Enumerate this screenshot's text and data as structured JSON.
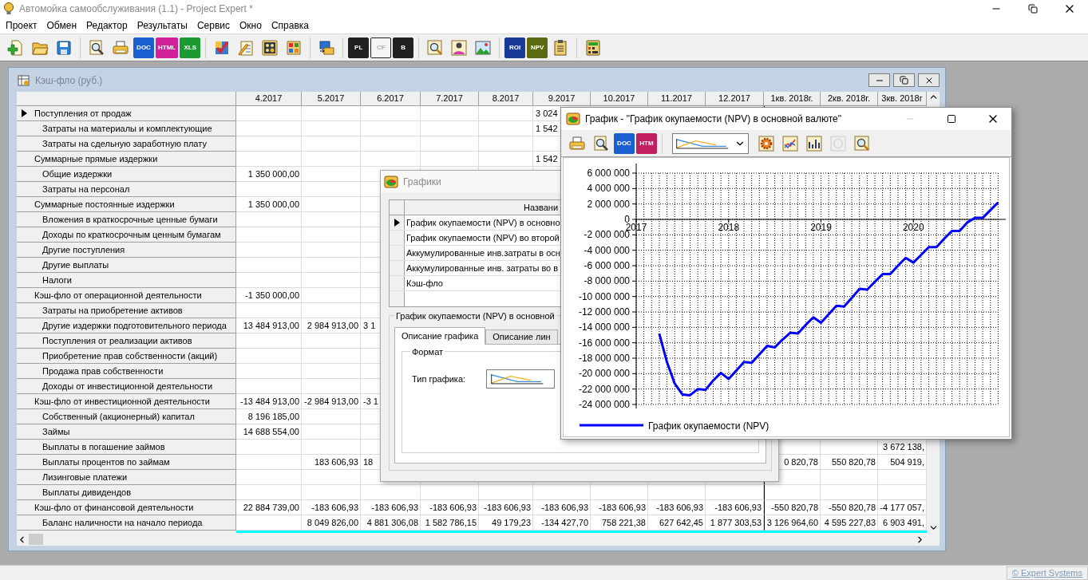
{
  "app": {
    "title": "Автомойка самообслуживания (1.1) - Project Expert *"
  },
  "menu": [
    "Проект",
    "Обмен",
    "Редактор",
    "Результаты",
    "Сервис",
    "Окно",
    "Справка"
  ],
  "toolbar": [
    {
      "kind": "new",
      "disabled": false
    },
    {
      "kind": "open",
      "disabled": false
    },
    {
      "kind": "save",
      "disabled": false
    },
    {
      "kind": "sep"
    },
    {
      "kind": "preview",
      "disabled": false
    },
    {
      "kind": "print",
      "disabled": false
    },
    {
      "kind": "badge",
      "text": "DOC",
      "color": "#1a5fd0",
      "disabled": false
    },
    {
      "kind": "badge",
      "text": "HTML",
      "color": "#d0209a",
      "disabled": false
    },
    {
      "kind": "badge",
      "text": "XLS",
      "color": "#1a9a30",
      "disabled": false
    },
    {
      "kind": "sep"
    },
    {
      "kind": "check",
      "disabled": false
    },
    {
      "kind": "pencil",
      "disabled": false
    },
    {
      "kind": "calc",
      "disabled": false
    },
    {
      "kind": "grid",
      "disabled": false
    },
    {
      "kind": "sep"
    },
    {
      "kind": "transfer",
      "disabled": false
    },
    {
      "kind": "sep"
    },
    {
      "kind": "badge",
      "text": "PL",
      "color": "#202020",
      "disabled": false
    },
    {
      "kind": "badge",
      "text": "CF",
      "color": "#202020",
      "disabled": true
    },
    {
      "kind": "badge",
      "text": "B",
      "color": "#202020",
      "disabled": false
    },
    {
      "kind": "sep"
    },
    {
      "kind": "zoom",
      "disabled": false
    },
    {
      "kind": "person",
      "disabled": false
    },
    {
      "kind": "picture",
      "disabled": false
    },
    {
      "kind": "sep"
    },
    {
      "kind": "badge",
      "text": "ROI",
      "color": "#1a3a9a",
      "disabled": false
    },
    {
      "kind": "badge",
      "text": "NPV",
      "color": "#5a6a10",
      "disabled": false
    },
    {
      "kind": "clipboard",
      "disabled": false
    },
    {
      "kind": "sep"
    },
    {
      "kind": "calculator",
      "disabled": false
    }
  ],
  "cashflow_window": {
    "title": "Кэш-фло (руб.)",
    "active": false,
    "columns": [
      "4.2017",
      "5.2017",
      "6.2017",
      "7.2017",
      "8.2017",
      "9.2017",
      "10.2017",
      "11.2017",
      "12.2017",
      "1кв. 2018г.",
      "2кв. 2018г.",
      "3кв. 2018г"
    ],
    "rows": [
      {
        "label": "Поступления от продаж",
        "kind": "total",
        "selected": true,
        "cells": [
          null,
          null,
          null,
          null,
          null,
          {
            "text": "3 024",
            "clip": true
          },
          null,
          null,
          null,
          null,
          null,
          null
        ]
      },
      {
        "label": "Затраты на материалы и комплектующие",
        "kind": "item",
        "selected": false,
        "cells": [
          null,
          null,
          null,
          null,
          null,
          {
            "text": "1 542",
            "clip": true
          },
          null,
          null,
          null,
          null,
          null,
          null
        ]
      },
      {
        "label": "Затраты на сдельную заработную плату",
        "kind": "item",
        "selected": false,
        "cells": [
          null,
          null,
          null,
          null,
          null,
          null,
          null,
          null,
          null,
          null,
          null,
          null
        ]
      },
      {
        "label": "Суммарные прямые издержки",
        "kind": "total",
        "selected": false,
        "cells": [
          null,
          null,
          null,
          null,
          null,
          {
            "text": "1 542",
            "clip": true
          },
          null,
          null,
          null,
          null,
          null,
          null
        ]
      },
      {
        "label": "Общие издержки",
        "kind": "item",
        "selected": false,
        "cells": [
          "1 350 000,00",
          null,
          null,
          null,
          null,
          null,
          null,
          null,
          null,
          null,
          null,
          null
        ]
      },
      {
        "label": "Затраты на персонал",
        "kind": "item",
        "selected": false,
        "cells": [
          null,
          null,
          null,
          null,
          null,
          null,
          null,
          null,
          null,
          null,
          null,
          null
        ]
      },
      {
        "label": "Суммарные постоянные издержки",
        "kind": "total",
        "selected": false,
        "cells": [
          "1 350 000,00",
          null,
          null,
          null,
          null,
          null,
          null,
          null,
          null,
          null,
          null,
          null
        ]
      },
      {
        "label": "Вложения в краткосрочные ценные бумаги",
        "kind": "item",
        "selected": false,
        "cells": [
          null,
          null,
          null,
          null,
          null,
          null,
          null,
          null,
          null,
          null,
          null,
          null
        ]
      },
      {
        "label": "Доходы по краткосрочным ценным бумагам",
        "kind": "item",
        "selected": false,
        "cells": [
          null,
          null,
          null,
          null,
          null,
          null,
          null,
          null,
          null,
          null,
          null,
          null
        ]
      },
      {
        "label": "Другие поступления",
        "kind": "item",
        "selected": false,
        "cells": [
          null,
          null,
          null,
          null,
          null,
          null,
          null,
          null,
          null,
          null,
          null,
          null
        ]
      },
      {
        "label": "Другие выплаты",
        "kind": "item",
        "selected": false,
        "cells": [
          null,
          null,
          null,
          null,
          null,
          null,
          null,
          null,
          null,
          null,
          null,
          null
        ]
      },
      {
        "label": "Налоги",
        "kind": "item",
        "selected": false,
        "cells": [
          null,
          null,
          null,
          null,
          null,
          null,
          null,
          null,
          null,
          null,
          null,
          null
        ]
      },
      {
        "label": "Кэш-фло от операционной деятельности",
        "kind": "total",
        "selected": false,
        "cells": [
          "-1 350 000,00",
          null,
          null,
          null,
          null,
          null,
          null,
          null,
          null,
          null,
          null,
          null
        ]
      },
      {
        "label": "Затраты на приобретение активов",
        "kind": "item",
        "selected": false,
        "cells": [
          null,
          null,
          null,
          null,
          null,
          null,
          null,
          null,
          null,
          null,
          null,
          null
        ]
      },
      {
        "label": "Другие издержки подготовительного периода",
        "kind": "item",
        "selected": false,
        "cells": [
          "13 484 913,00",
          "2 984 913,00",
          {
            "text": "3 1",
            "clip": true
          },
          null,
          null,
          null,
          null,
          null,
          null,
          null,
          null,
          null
        ]
      },
      {
        "label": "Поступления от реализации активов",
        "kind": "item",
        "selected": false,
        "cells": [
          null,
          null,
          null,
          null,
          null,
          null,
          null,
          null,
          null,
          null,
          null,
          null
        ]
      },
      {
        "label": "Приобретение прав собственности (акций)",
        "kind": "item",
        "selected": false,
        "cells": [
          null,
          null,
          null,
          null,
          null,
          null,
          null,
          null,
          null,
          null,
          null,
          null
        ]
      },
      {
        "label": "Продажа прав собственности",
        "kind": "item",
        "selected": false,
        "cells": [
          null,
          null,
          null,
          null,
          null,
          null,
          null,
          null,
          null,
          null,
          null,
          null
        ]
      },
      {
        "label": "Доходы от инвестиционной деятельности",
        "kind": "item",
        "selected": false,
        "cells": [
          null,
          null,
          null,
          null,
          null,
          null,
          null,
          null,
          null,
          null,
          null,
          null
        ]
      },
      {
        "label": "Кэш-фло от инвестиционной деятельности",
        "kind": "total",
        "selected": false,
        "cells": [
          "-13 484 913,00",
          "-2 984 913,00",
          {
            "text": "-3 1",
            "clip": true
          },
          null,
          null,
          null,
          null,
          null,
          null,
          null,
          null,
          null
        ]
      },
      {
        "label": "Собственный (акционерный) капитал",
        "kind": "item",
        "selected": false,
        "cells": [
          "8 196 185,00",
          null,
          null,
          null,
          null,
          null,
          null,
          null,
          null,
          null,
          null,
          null
        ]
      },
      {
        "label": "Займы",
        "kind": "item",
        "selected": false,
        "cells": [
          "14 688 554,00",
          null,
          null,
          null,
          null,
          null,
          null,
          null,
          null,
          null,
          null,
          null
        ]
      },
      {
        "label": "Выплаты в погашение займов",
        "kind": "item",
        "selected": false,
        "cells": [
          null,
          null,
          null,
          null,
          null,
          null,
          null,
          null,
          null,
          null,
          null,
          "3 672 138,"
        ]
      },
      {
        "label": "Выплаты процентов по займам",
        "kind": "item",
        "selected": false,
        "cells": [
          null,
          "183 606,93",
          {
            "text": "18",
            "clip": true
          },
          null,
          null,
          null,
          null,
          null,
          null,
          "0 820,78",
          "550 820,78",
          "504 919,"
        ]
      },
      {
        "label": "Лизинговые платежи",
        "kind": "item",
        "selected": false,
        "cells": [
          null,
          null,
          null,
          null,
          null,
          null,
          null,
          null,
          null,
          null,
          null,
          null
        ]
      },
      {
        "label": "Выплаты дивидендов",
        "kind": "item",
        "selected": false,
        "cells": [
          null,
          null,
          null,
          null,
          null,
          null,
          null,
          null,
          null,
          null,
          null,
          null
        ]
      },
      {
        "label": "Кэш-фло от финансовой деятельности",
        "kind": "total",
        "selected": false,
        "cells": [
          "22 884 739,00",
          "-183 606,93",
          "-183 606,93",
          "-183 606,93",
          "-183 606,93",
          "-183 606,93",
          "-183 606,93",
          "-183 606,93",
          "-183 606,93",
          "-550 820,78",
          "-550 820,78",
          "-4 177 057,"
        ]
      },
      {
        "label": "Баланс наличности на начало периода",
        "kind": "item",
        "selected": false,
        "cells": [
          null,
          "8 049 826,00",
          "4 881 306,08",
          "1 582 786,15",
          "49 179,23",
          "-134 427,70",
          "758 221,38",
          "627 642,45",
          "1 877 303,53",
          "3 126 964,60",
          "4 595 227,83",
          "6 903 491,"
        ]
      }
    ],
    "partial_row_highlighted": true
  },
  "charts_dialog": {
    "title": "Графики",
    "active": false,
    "list_header": "Названи",
    "items": [
      {
        "name": "График окупаемости (NPV) в основно",
        "selected": true
      },
      {
        "name": "График окупаемости (NPV) во второй",
        "selected": false
      },
      {
        "name": "Аккумулированные инв.затраты в осн",
        "selected": false
      },
      {
        "name": "Аккумулированные инв. затраты во в",
        "selected": false
      },
      {
        "name": "Кэш-фло",
        "selected": false
      }
    ],
    "section_title": "График окупаемости (NPV) в основной",
    "tabs": [
      {
        "label": "Описание графика",
        "selected": true
      },
      {
        "label": "Описание лин",
        "selected": false
      }
    ],
    "format_group": "Формат",
    "chart_type_label": "Тип графика:"
  },
  "chart_window": {
    "title": "График - \"График окупаемости (NPV) в основной валюте\"",
    "active": true,
    "toolbar": [
      {
        "kind": "print",
        "disabled": false
      },
      {
        "kind": "preview",
        "disabled": false
      },
      {
        "kind": "badge",
        "text": "DOC",
        "color": "#1a5fd0",
        "disabled": false
      },
      {
        "kind": "badge",
        "text": "HTM",
        "color": "#c02060",
        "disabled": false
      },
      {
        "kind": "sep"
      },
      {
        "kind": "combo",
        "disabled": false
      },
      {
        "kind": "gear",
        "disabled": false
      },
      {
        "kind": "lines",
        "disabled": false
      },
      {
        "kind": "bars",
        "disabled": false
      },
      {
        "kind": "cube",
        "disabled": true
      },
      {
        "kind": "zoom",
        "disabled": false
      }
    ],
    "chart_data": {
      "type": "line",
      "grid": true,
      "xlim": [
        2017,
        2021
      ],
      "ylim": [
        -24000000,
        6000000
      ],
      "xticks": [
        2017,
        2018,
        2019,
        2020
      ],
      "yticks": [
        {
          "value": 6000000,
          "label": "6 000 000"
        },
        {
          "value": 4000000,
          "label": "4 000 000"
        },
        {
          "value": 2000000,
          "label": "2 000 000"
        },
        {
          "value": 0,
          "label": "0"
        },
        {
          "value": -2000000,
          "label": "-2 000 000"
        },
        {
          "value": -4000000,
          "label": "-4 000 000"
        },
        {
          "value": -6000000,
          "label": "-6 000 000"
        },
        {
          "value": -8000000,
          "label": "-8 000 000"
        },
        {
          "value": -10000000,
          "label": "-10 000 000"
        },
        {
          "value": -12000000,
          "label": "-12 000 000"
        },
        {
          "value": -14000000,
          "label": "-14 000 000"
        },
        {
          "value": -16000000,
          "label": "-16 000 000"
        },
        {
          "value": -18000000,
          "label": "-18 000 000"
        },
        {
          "value": -20000000,
          "label": "-20 000 000"
        },
        {
          "value": -22000000,
          "label": "-22 000 000"
        },
        {
          "value": -24000000,
          "label": "-24 000 000"
        }
      ],
      "x": [
        2017.25,
        2017.333,
        2017.417,
        2017.5,
        2017.583,
        2017.667,
        2017.75,
        2017.833,
        2017.917,
        2018,
        2018.083,
        2018.167,
        2018.25,
        2018.333,
        2018.417,
        2018.5,
        2018.583,
        2018.667,
        2018.75,
        2018.833,
        2018.917,
        2019,
        2019.083,
        2019.167,
        2019.25,
        2019.333,
        2019.417,
        2019.5,
        2019.583,
        2019.667,
        2019.75,
        2019.833,
        2019.917,
        2020,
        2020.083,
        2020.167,
        2020.25,
        2020.333,
        2020.417,
        2020.5,
        2020.583,
        2020.667,
        2020.75,
        2020.833,
        2020.917
      ],
      "series": [
        {
          "name": "График окупаемости (NPV)",
          "color": "#0000ff",
          "values": [
            -14800000,
            -18500000,
            -21300000,
            -22700000,
            -22800000,
            -22000000,
            -22100000,
            -20900000,
            -19900000,
            -20700000,
            -19600000,
            -18500000,
            -18600000,
            -17500000,
            -16400000,
            -16600000,
            -15600000,
            -14700000,
            -14800000,
            -13700000,
            -12700000,
            -13400000,
            -12300000,
            -11200000,
            -11300000,
            -10200000,
            -9000000,
            -9100000,
            -8100000,
            -7100000,
            -7100000,
            -6000000,
            -5000000,
            -5600000,
            -4600000,
            -3600000,
            -3600000,
            -2500000,
            -1500000,
            -1500000,
            -400000,
            200000,
            200000,
            1200000,
            2200000
          ]
        }
      ]
    }
  },
  "status_bar": {
    "link": "© Expert Systems"
  }
}
